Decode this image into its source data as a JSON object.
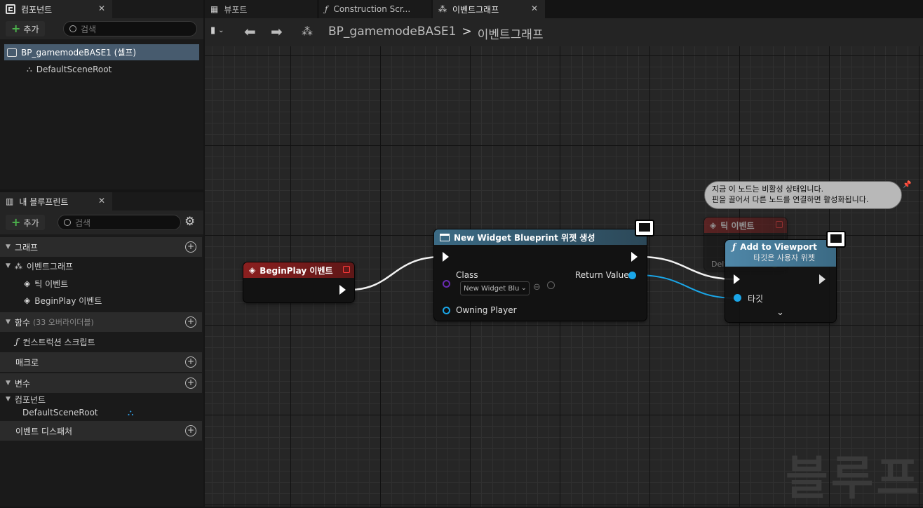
{
  "left_panel": {
    "components_tab": "컴포넌트",
    "add_label": "추가",
    "search_placeholder": "검색",
    "self_item": "BP_gamemodeBASE1 (셀프)",
    "root_item": "DefaultSceneRoot"
  },
  "blueprint_panel": {
    "tab": "내 블루프린트",
    "add_label": "추가",
    "search_placeholder": "검색",
    "sections": {
      "graphs": "그래프",
      "functions": "함수",
      "functions_sub": "(33 오버라이더블)",
      "macros": "매크로",
      "variables": "변수",
      "dispatchers": "이벤트 디스패처"
    },
    "event_graph": "이벤트그래프",
    "tick_event": "틱 이벤트",
    "beginplay_event": "BeginPlay 이벤트",
    "construction_script": "컨스트럭션 스크립트",
    "components_category": "컴포넌트",
    "component_var": "DefaultSceneRoot"
  },
  "tabs": {
    "viewport": "뷰포트",
    "construction": "Construction Scr...",
    "event_graph": "이벤트그래프"
  },
  "breadcrumb": {
    "blueprint": "BP_gamemodeBASE1",
    "sep": ">",
    "graph": "이벤트그래프"
  },
  "nodes": {
    "beginplay": {
      "title": "BeginPlay 이벤트"
    },
    "create_widget": {
      "title": "New Widget Blueprint 위젯 생성",
      "class_label": "Class",
      "class_value": "New Widget Blu",
      "owning_player": "Owning Player",
      "return_value": "Return Value"
    },
    "tick": {
      "title": "틱 이벤트",
      "pin": "Delta Seconds"
    },
    "add_to_viewport": {
      "title": "Add to Viewport",
      "subtitle": "타깃은 사용자 위젯",
      "target": "타깃"
    }
  },
  "tooltip": {
    "line1": "지금 이 노드는 비활성 상태입니다.",
    "line2": "핀을 끌어서 다른 노드를 연결하면 활성화됩니다."
  },
  "watermark": "블루프리",
  "colors": {
    "event_red": "#8b1f1f",
    "function_blue": "#3b6a84",
    "object_pin": "#1aa6e8",
    "class_pin": "#6a2bb3",
    "exec_wire": "#ffffff",
    "add_green": "#4cb34c"
  }
}
